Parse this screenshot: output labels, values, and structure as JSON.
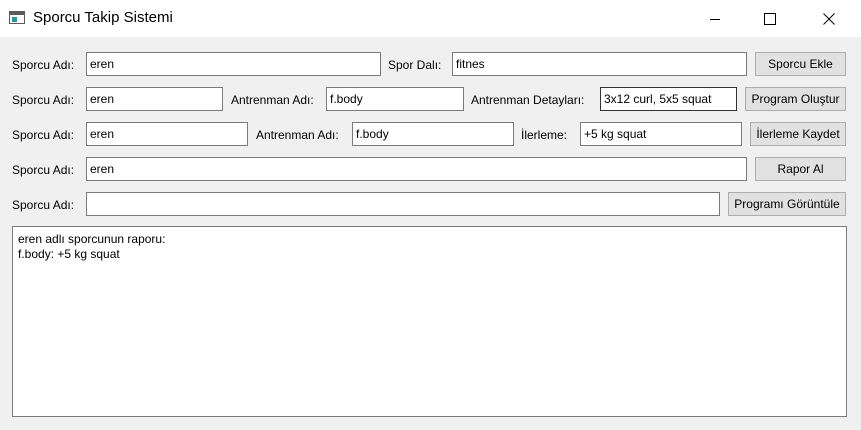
{
  "window": {
    "title": "Sporcu Takip Sistemi",
    "icon": "app-window-icon",
    "controls": [
      "minimize-icon",
      "maximize-icon",
      "close-icon"
    ]
  },
  "row1": {
    "name_label": "Sporcu Adı:",
    "name_value": "eren",
    "sport_label": "Spor Dalı:",
    "sport_value": "fitnes",
    "button": "Sporcu Ekle"
  },
  "row2": {
    "name_label": "Sporcu Adı:",
    "name_value": "eren",
    "training_label": "Antrenman Adı:",
    "training_value": "f.body",
    "details_label": "Antrenman Detayları:",
    "details_value": "3x12 curl, 5x5 squat",
    "button": "Program Oluştur"
  },
  "row3": {
    "name_label": "Sporcu Adı:",
    "name_value": "eren",
    "training_label": "Antrenman Adı:",
    "training_value": "f.body",
    "progress_label": "İlerleme:",
    "progress_value": "+5 kg squat",
    "button": "İlerleme Kaydet"
  },
  "row4": {
    "name_label": "Sporcu Adı:",
    "name_value": "eren",
    "button": "Rapor Al"
  },
  "row5": {
    "name_label": "Sporcu Adı:",
    "name_value": "",
    "button": "Programı Görüntüle"
  },
  "output": {
    "lines": [
      "eren adlı sporcunun raporu:",
      "f.body: +5 kg squat"
    ]
  }
}
